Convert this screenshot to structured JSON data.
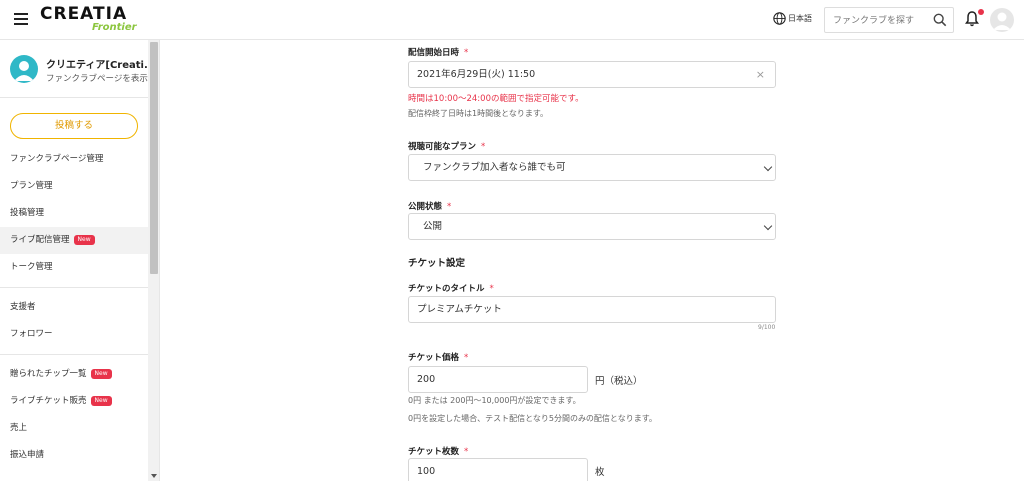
{
  "header": {
    "logo_main": "CREATIA",
    "logo_sub": "Frontier",
    "language": "日本語",
    "search_placeholder": "ファンクラブを探す"
  },
  "sidebar": {
    "profile_name": "クリエティア[Creati...",
    "profile_link": "ファンクラブページを表示",
    "post_button": "投稿する",
    "badge_new": "New",
    "group1": [
      {
        "label": "ファンクラブページ管理"
      },
      {
        "label": "プラン管理"
      },
      {
        "label": "投稿管理"
      },
      {
        "label": "ライブ配信管理"
      },
      {
        "label": "トーク管理"
      }
    ],
    "group2": [
      {
        "label": "支援者"
      },
      {
        "label": "フォロワー"
      }
    ],
    "group3": [
      {
        "label": "贈られたチップ一覧"
      },
      {
        "label": "ライブチケット販売"
      },
      {
        "label": "売上"
      },
      {
        "label": "振込申請"
      }
    ]
  },
  "form": {
    "start_label": "配信開始日時",
    "required_mark": "*",
    "start_value": "2021年6月29日(火) 11:50",
    "start_clear": "×",
    "start_error": "時間は10:00〜24:00の範囲で指定可能です。",
    "start_note": "配信枠終了日時は1時間後となります。",
    "plan_label": "視聴可能なプラン",
    "plan_value": "ファンクラブ加入者なら誰でも可",
    "status_label": "公開状態",
    "status_value": "公開",
    "ticket_section": "チケット設定",
    "ticket_title_label": "チケットのタイトル",
    "ticket_title_value": "プレミアムチケット",
    "ticket_title_counter": "9/100",
    "price_label": "チケット価格",
    "price_value": "200",
    "price_unit": "円（税込）",
    "price_note1": "0円 または 200円〜10,000円が設定できます。",
    "price_note2": "0円を設定した場合、テスト配信となり5分間のみの配信となります。",
    "count_label": "チケット枚数",
    "count_value": "100",
    "count_unit": "枚"
  },
  "colors": {
    "accent_red": "#e8334a",
    "brand_green": "#8cc63f",
    "post_button_border": "#f0b400"
  },
  "icons": [
    "menu-icon",
    "globe-icon",
    "search-icon",
    "bell-icon",
    "user-avatar-icon",
    "chevron-down-icon",
    "close-icon"
  ]
}
